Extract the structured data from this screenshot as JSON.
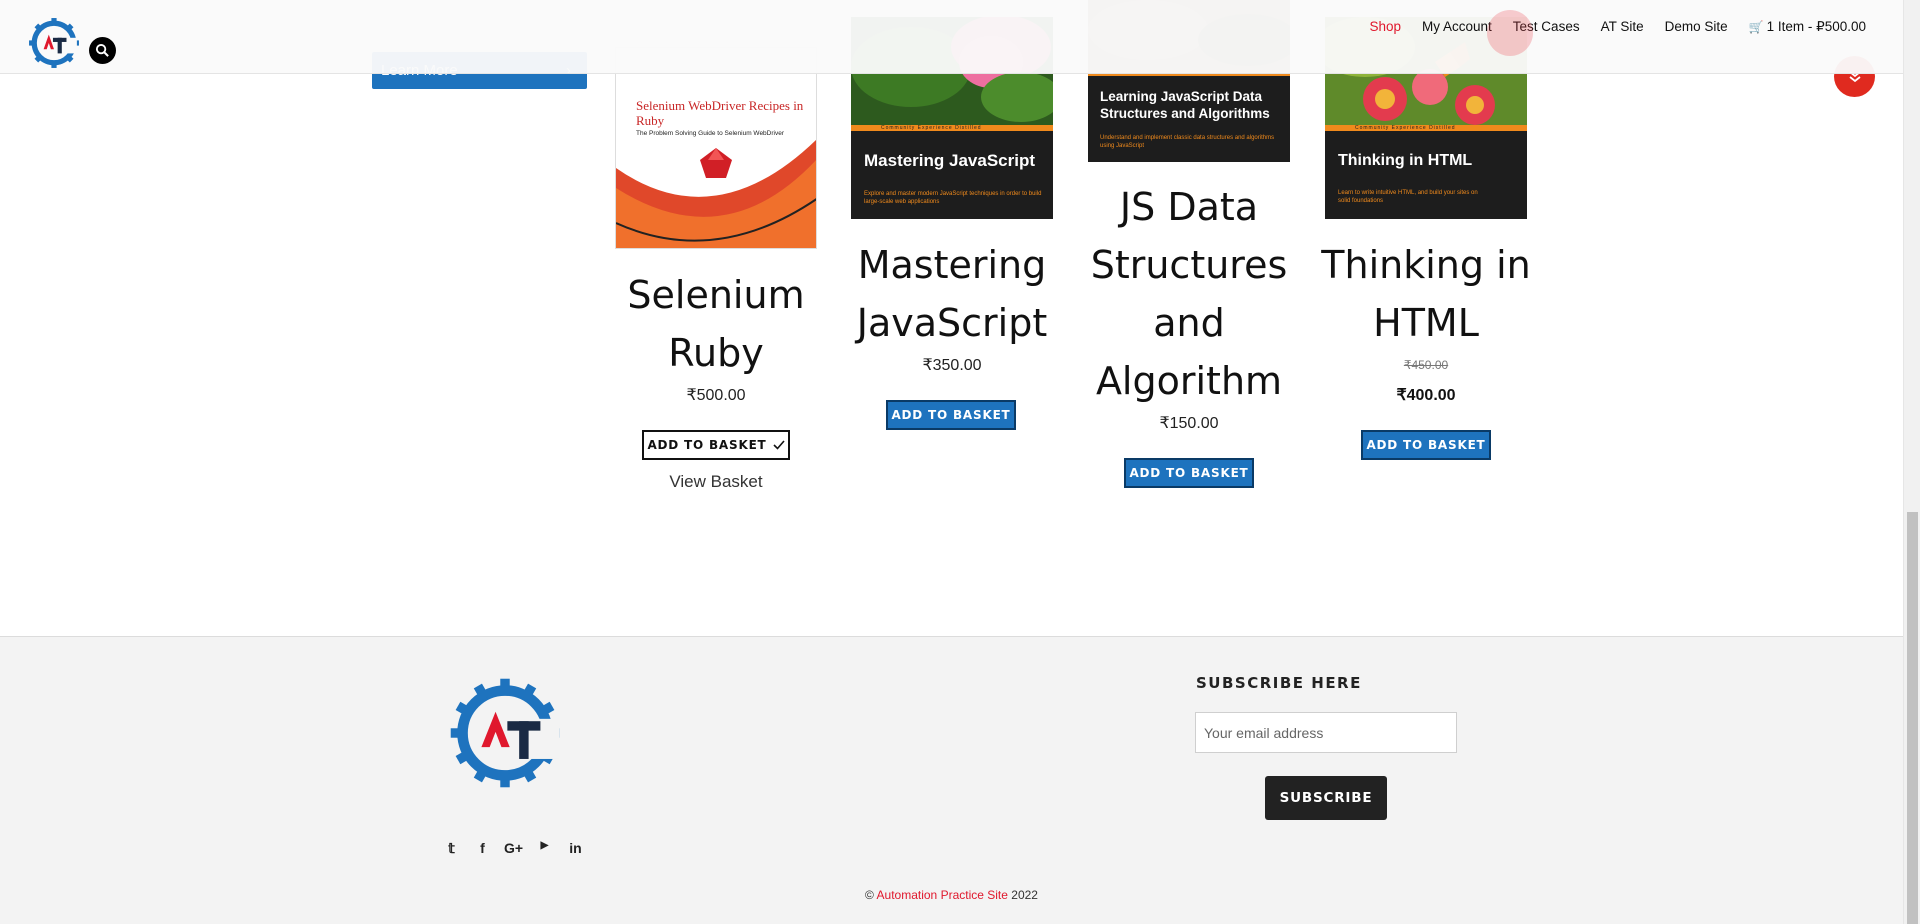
{
  "header": {
    "logo_icon": "automation-testing-gear-logo",
    "search_icon": "search-icon",
    "nav": [
      {
        "label": "Shop",
        "active": true
      },
      {
        "label": "My Account"
      },
      {
        "label": "Test Cases"
      },
      {
        "label": "AT Site"
      },
      {
        "label": "Demo Site"
      }
    ],
    "cart_icon": "shopping-cart-icon",
    "cart_label": "1 Item - ₽500.00"
  },
  "banner": {
    "learn_more": "Learn More",
    "arrow_icon": "chevron-right-icon"
  },
  "products": [
    {
      "cover_title": "Selenium WebDriver Recipes in Ruby",
      "cover_subtitle": "The Problem Solving Guide to Selenium WebDriver",
      "title_line1": "Selenium",
      "title_line2": "Ruby",
      "price": "₹500.00",
      "button": "ADD TO BASKET",
      "added": true,
      "view_basket": "View Basket"
    },
    {
      "cover_title": "Mastering JavaScript",
      "cover_desc": "Explore and master modern JavaScript techniques in order to build large-scale web applications",
      "cover_series": "Community Experience Distilled",
      "title_line1": "Mastering",
      "title_line2": "JavaScript",
      "price": "₹350.00",
      "button": "ADD TO BASKET"
    },
    {
      "cover_title": "Learning JavaScript Data Structures and Algorithms",
      "cover_desc": "Understand and implement classic data structures and algorithms using JavaScript",
      "title_line1": "JS Data",
      "title_line2": "Structures",
      "title_line3": "and",
      "title_line4": "Algorithm",
      "price": "₹150.00",
      "button": "ADD TO BASKET"
    },
    {
      "cover_title": "Thinking in HTML",
      "cover_desc": "Learn to write intuitive HTML, and build your sites on solid foundations",
      "cover_series": "Community Experience Distilled",
      "title_line1": "Thinking in",
      "title_line2": "HTML",
      "price_old": "₹450.00",
      "price": "₹400.00",
      "button": "ADD TO BASKET"
    }
  ],
  "footer": {
    "social_icons": [
      "twitter-icon",
      "facebook-icon",
      "google-plus-icon",
      "youtube-icon",
      "linkedin-icon"
    ],
    "subscribe_title": "SUBSCRIBE HERE",
    "email_placeholder": "Your email address",
    "subscribe_button": "SUBSCRIBE",
    "copyright_prefix": "©",
    "copyright_link": "Automation Practice Site",
    "copyright_year": "2022"
  },
  "colors": {
    "accent_blue": "#1e73be",
    "accent_red": "#e0182d",
    "footer_bg": "#f3f3f3"
  }
}
